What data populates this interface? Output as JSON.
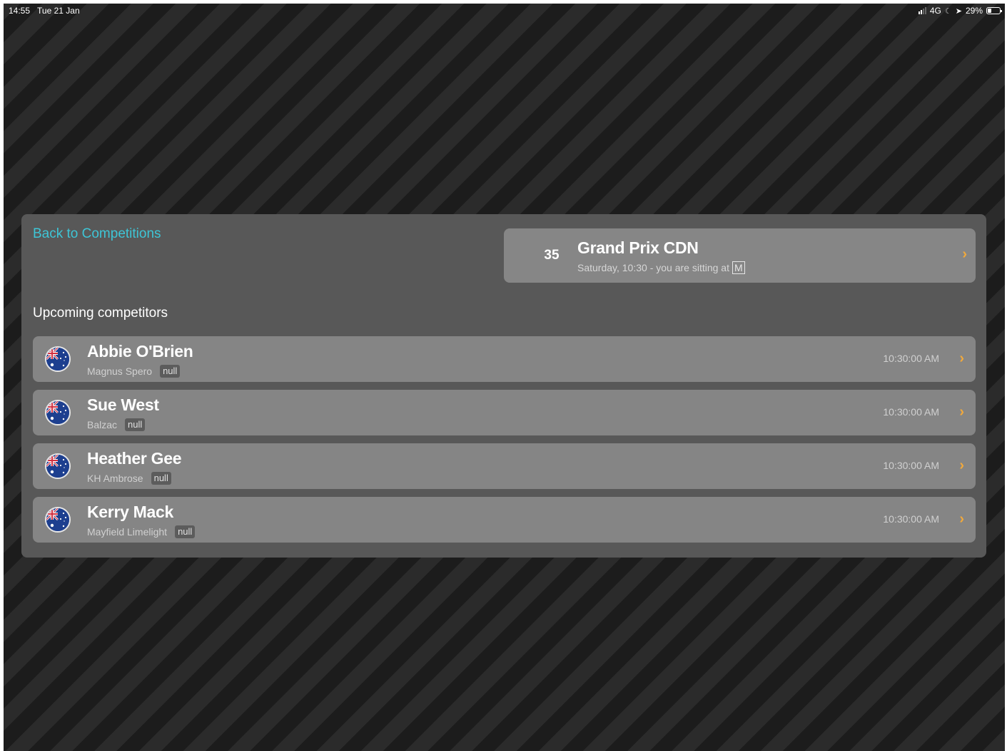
{
  "status_bar": {
    "time": "14:55",
    "date": "Tue 21 Jan",
    "network": "4G",
    "battery": "29%",
    "battery_level": 0.29
  },
  "back_link": "Back to Competitions",
  "competition": {
    "number": "35",
    "title": "Grand Prix CDN",
    "subtitle": "Saturday, 10:30 - you are sitting at",
    "seat": "M"
  },
  "section_title": "Upcoming competitors",
  "competitors": [
    {
      "name": "Abbie O'Brien",
      "horse": "Magnus Spero",
      "badge": "null",
      "time": "10:30:00 AM",
      "flag": "australia-flag-icon"
    },
    {
      "name": "Sue West",
      "horse": "Balzac",
      "badge": "null",
      "time": "10:30:00 AM",
      "flag": "australia-flag-icon"
    },
    {
      "name": "Heather Gee",
      "horse": "KH Ambrose",
      "badge": "null",
      "time": "10:30:00 AM",
      "flag": "australia-flag-icon"
    },
    {
      "name": "Kerry Mack",
      "horse": "Mayfield Limelight",
      "badge": "null",
      "time": "10:30:00 AM",
      "flag": "australia-flag-icon"
    }
  ],
  "colors": {
    "accent_link": "#3ec5d6",
    "chevron": "#f2a93b",
    "panel": "#585858",
    "card": "#868686"
  }
}
